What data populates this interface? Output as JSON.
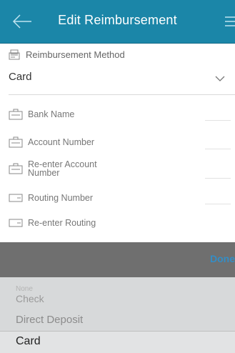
{
  "header": {
    "title": "Edit Reimbursement"
  },
  "method": {
    "label": "Reimbursement Method",
    "value": "Card"
  },
  "fields": [
    {
      "label": "Bank Name"
    },
    {
      "label": "Account Number"
    },
    {
      "label_line1": "Re-enter Account",
      "label_line2": "Number"
    },
    {
      "label": "Routing Number"
    },
    {
      "label": "Re-enter Routing"
    }
  ],
  "picker": {
    "done_label": "Done",
    "options": [
      "None",
      "Check",
      "Direct Deposit",
      "Card"
    ],
    "selected": "Card"
  },
  "colors": {
    "header_bg": "#1b86a8",
    "toolbar_bg": "#6f6f6f",
    "picker_bg": "#d7d9da",
    "done_color": "#2a93d5"
  }
}
